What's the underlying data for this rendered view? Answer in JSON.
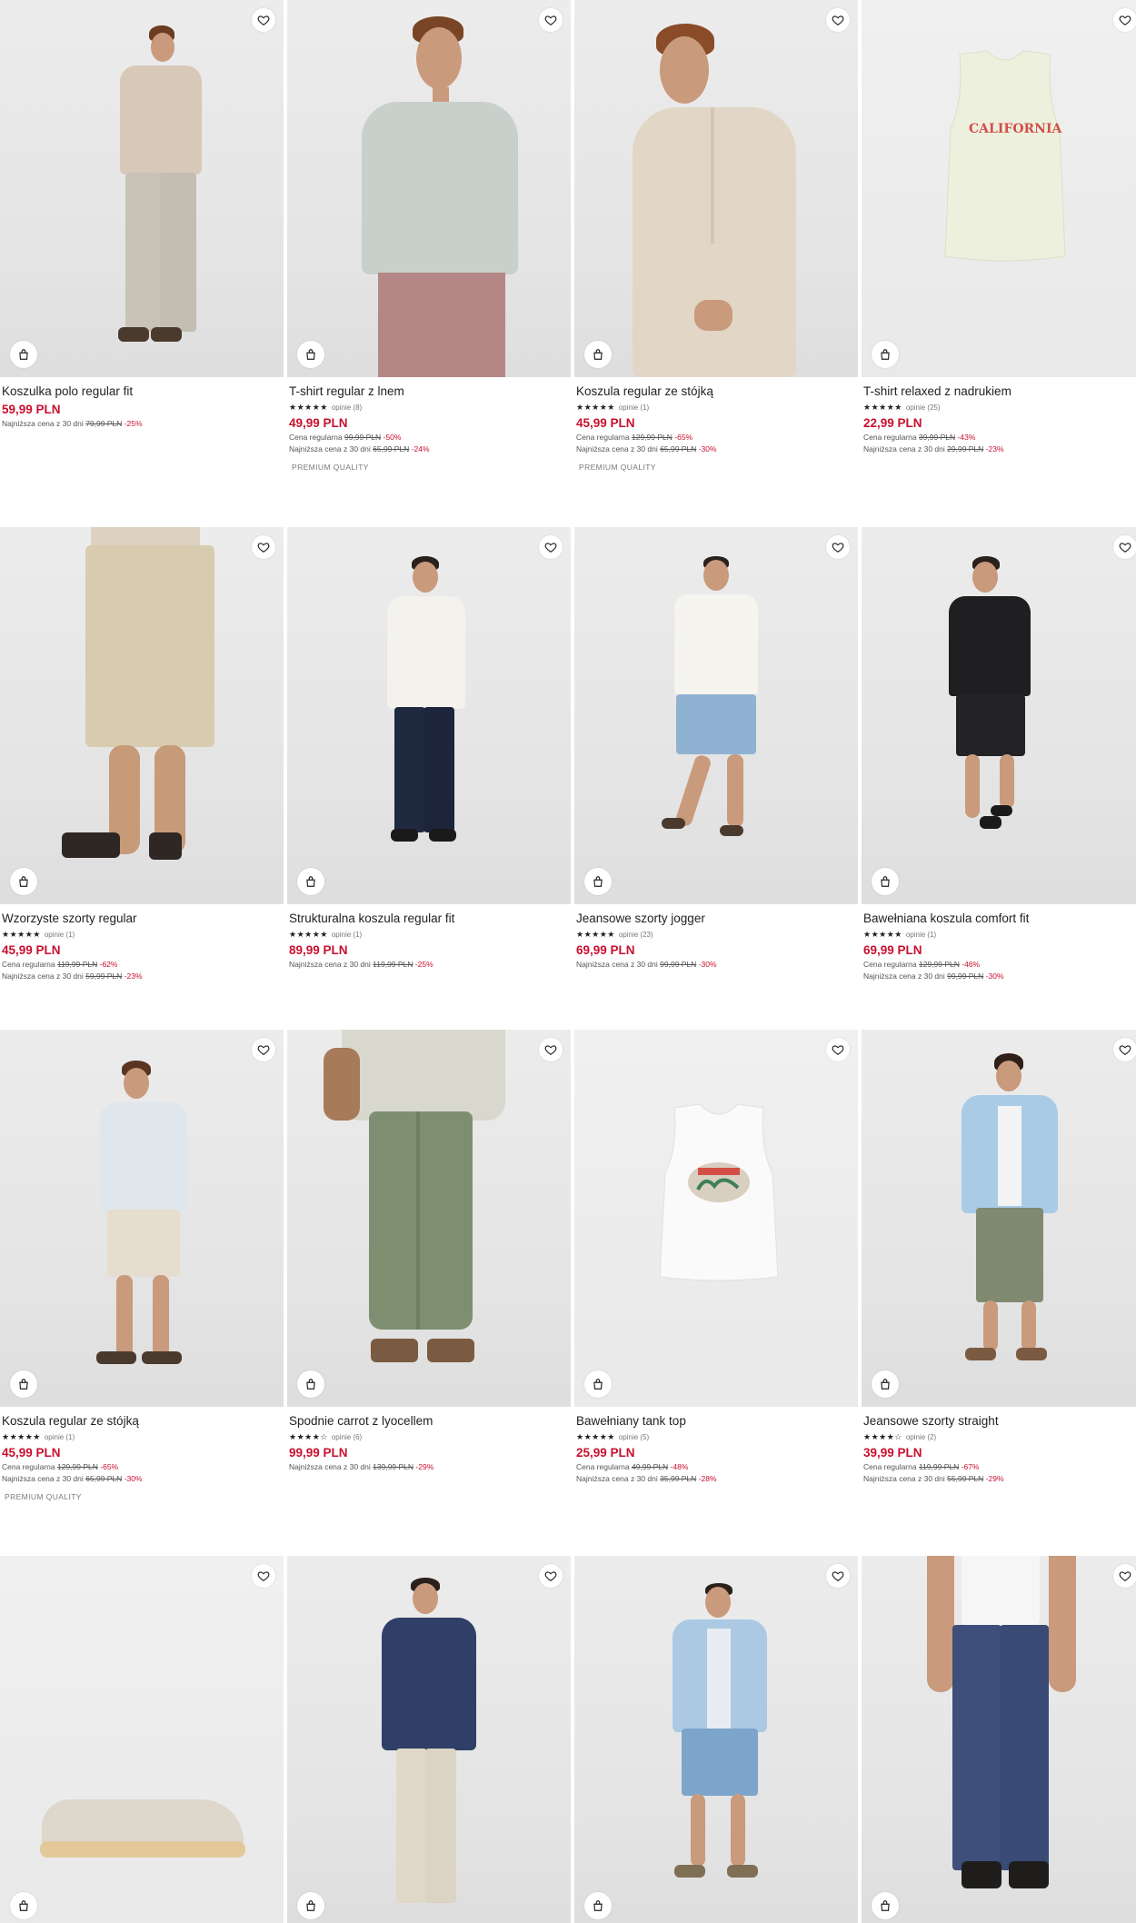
{
  "products": [
    {
      "name": "Koszulka polo regular fit",
      "stars": "",
      "reviews": "",
      "price": "59,99 PLN",
      "regular_label": "",
      "regular_price": "",
      "regular_disc": "",
      "lowest_label": "Najniższa cena z 30 dni",
      "lowest_price": "79,99 PLN",
      "lowest_disc": "-25%",
      "badge": ""
    },
    {
      "name": "T-shirt regular z lnem",
      "stars": "★★★★★",
      "reviews": "opinie (8)",
      "price": "49,99 PLN",
      "regular_label": "Cena regularna",
      "regular_price": "99,99 PLN",
      "regular_disc": "-50%",
      "lowest_label": "Najniższa cena z 30 dni",
      "lowest_price": "65,99 PLN",
      "lowest_disc": "-24%",
      "badge": "PREMIUM QUALITY"
    },
    {
      "name": "Koszula regular ze stójką",
      "stars": "★★★★★",
      "reviews": "opinie (1)",
      "price": "45,99 PLN",
      "regular_label": "Cena regularna",
      "regular_price": "129,99 PLN",
      "regular_disc": "-65%",
      "lowest_label": "Najniższa cena z 30 dni",
      "lowest_price": "65,99 PLN",
      "lowest_disc": "-30%",
      "badge": "PREMIUM QUALITY"
    },
    {
      "name": "T-shirt relaxed z nadrukiem",
      "stars": "★★★★★",
      "reviews": "opinie (25)",
      "price": "22,99 PLN",
      "regular_label": "Cena regularna",
      "regular_price": "39,99 PLN",
      "regular_disc": "-43%",
      "lowest_label": "Najniższa cena z 30 dni",
      "lowest_price": "29,99 PLN",
      "lowest_disc": "-23%",
      "badge": "",
      "print_text": "CALIFORNIA"
    },
    {
      "name": "Wzorzyste szorty regular",
      "stars": "★★★★★",
      "reviews": "opinie (1)",
      "price": "45,99 PLN",
      "regular_label": "Cena regularna",
      "regular_price": "119,99 PLN",
      "regular_disc": "-62%",
      "lowest_label": "Najniższa cena z 30 dni",
      "lowest_price": "59,99 PLN",
      "lowest_disc": "-23%",
      "badge": ""
    },
    {
      "name": "Strukturalna koszula regular fit",
      "stars": "★★★★★",
      "reviews": "opinie (1)",
      "price": "89,99 PLN",
      "regular_label": "",
      "regular_price": "",
      "regular_disc": "",
      "lowest_label": "Najniższa cena z 30 dni",
      "lowest_price": "119,99 PLN",
      "lowest_disc": "-25%",
      "badge": ""
    },
    {
      "name": "Jeansowe szorty jogger",
      "stars": "★★★★★",
      "reviews": "opinie (23)",
      "price": "69,99 PLN",
      "regular_label": "",
      "regular_price": "",
      "regular_disc": "",
      "lowest_label": "Najniższa cena z 30 dni",
      "lowest_price": "99,99 PLN",
      "lowest_disc": "-30%",
      "badge": ""
    },
    {
      "name": "Bawełniana koszula comfort fit",
      "stars": "★★★★★",
      "reviews": "opinie (1)",
      "price": "69,99 PLN",
      "regular_label": "Cena regularna",
      "regular_price": "129,99 PLN",
      "regular_disc": "-46%",
      "lowest_label": "Najniższa cena z 30 dni",
      "lowest_price": "99,99 PLN",
      "lowest_disc": "-30%",
      "badge": ""
    },
    {
      "name": "Koszula regular ze stójką",
      "stars": "★★★★★",
      "reviews": "opinie (1)",
      "price": "45,99 PLN",
      "regular_label": "Cena regularna",
      "regular_price": "129,99 PLN",
      "regular_disc": "-65%",
      "lowest_label": "Najniższa cena z 30 dni",
      "lowest_price": "65,99 PLN",
      "lowest_disc": "-30%",
      "badge": "PREMIUM QUALITY"
    },
    {
      "name": "Spodnie carrot z lyocellem",
      "stars": "★★★★☆",
      "reviews": "opinie (6)",
      "price": "99,99 PLN",
      "regular_label": "",
      "regular_price": "",
      "regular_disc": "",
      "lowest_label": "Najniższa cena z 30 dni",
      "lowest_price": "139,99 PLN",
      "lowest_disc": "-29%",
      "badge": ""
    },
    {
      "name": "Bawełniany tank top",
      "stars": "★★★★★",
      "reviews": "opinie (5)",
      "price": "25,99 PLN",
      "regular_label": "Cena regularna",
      "regular_price": "49,99 PLN",
      "regular_disc": "-48%",
      "lowest_label": "Najniższa cena z 30 dni",
      "lowest_price": "35,99 PLN",
      "lowest_disc": "-28%",
      "badge": ""
    },
    {
      "name": "Jeansowe szorty straight",
      "stars": "★★★★☆",
      "reviews": "opinie (2)",
      "price": "39,99 PLN",
      "regular_label": "Cena regularna",
      "regular_price": "119,99 PLN",
      "regular_disc": "-67%",
      "lowest_label": "Najniższa cena z 30 dni",
      "lowest_price": "55,99 PLN",
      "lowest_disc": "-29%",
      "badge": ""
    }
  ],
  "icons": {
    "favorite": "heart-icon",
    "cart": "shopping-bag-icon"
  },
  "colors": {
    "price": "#c8102e",
    "discount": "#c8102e",
    "text": "#222222"
  }
}
